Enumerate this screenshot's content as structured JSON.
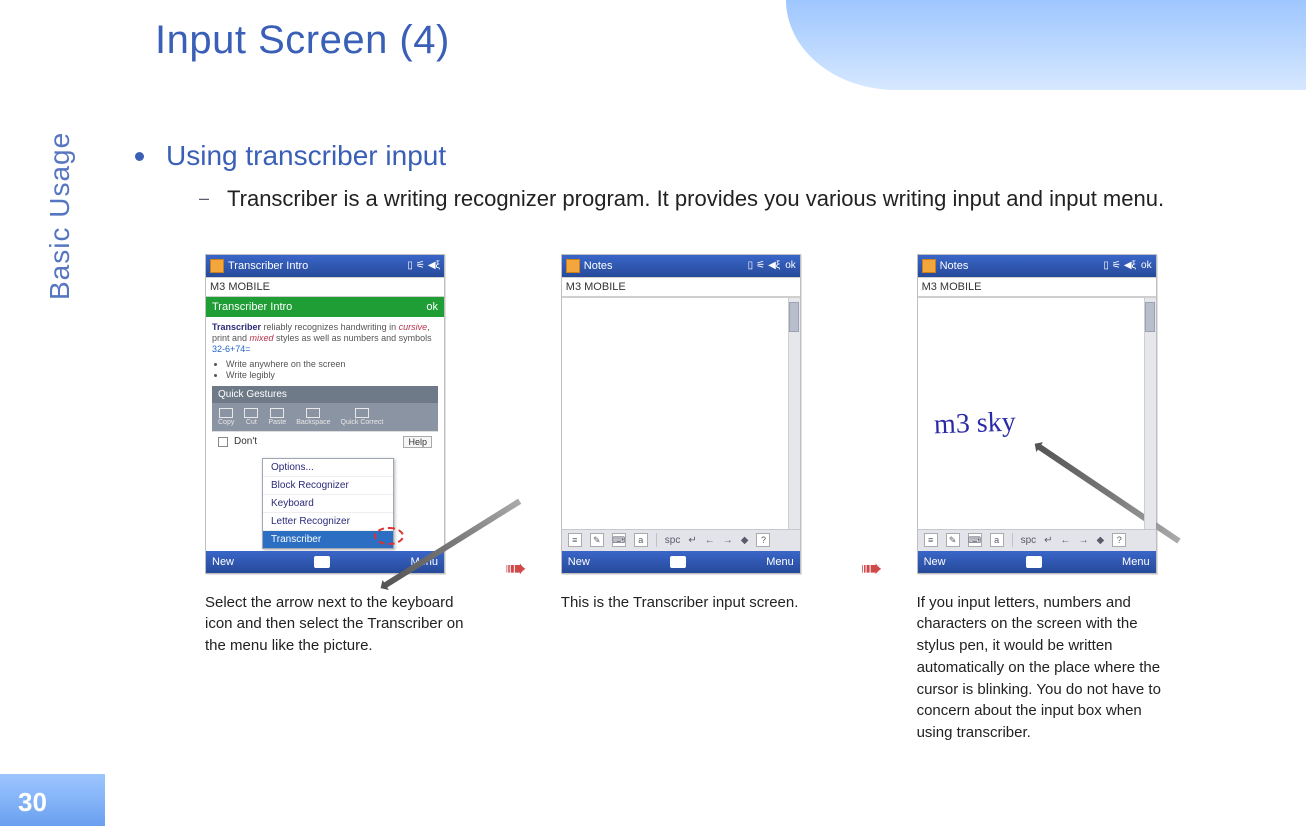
{
  "title": "Input Screen (4)",
  "side_label": "Basic Usage",
  "page_number": "30",
  "bullet": "Using transcriber input",
  "subpoint": "Transcriber is a writing recognizer program. It provides you various writing input and input menu.",
  "device1": {
    "title": "Transcriber Intro",
    "addr": "M3 MOBILE",
    "greenbar_title": "Transcriber Intro",
    "greenbar_ok": "ok",
    "intro_strong": "Transcriber",
    "intro_rest1": " reliably recognizes handwriting in ",
    "intro_cursive": "cursive",
    "intro_rest2": ", print and ",
    "intro_mixed": "mixed",
    "intro_rest3": " styles as well as numbers and symbols ",
    "intro_nums": "32-6+74=",
    "tips": [
      "Write anywhere on the screen",
      "Write legibly"
    ],
    "gestures_label": "Quick Gestures",
    "gesture_names": [
      "Copy",
      "Cut",
      "Paste",
      "Backspace",
      "Quick Correct"
    ],
    "dont_label": "Don't",
    "help_label": "Help",
    "popup": [
      "Options...",
      "Block Recognizer",
      "Keyboard",
      "Letter Recognizer",
      "Transcriber"
    ],
    "foot_new": "New",
    "foot_menu": "Menu"
  },
  "device2": {
    "title": "Notes",
    "addr": "M3 MOBILE",
    "ok": "ok",
    "toolbar_spc": "spc",
    "foot_new": "New",
    "foot_menu": "Menu"
  },
  "device3": {
    "title": "Notes",
    "addr": "M3 MOBILE",
    "ok": "ok",
    "handwriting": "m3 sky",
    "toolbar_spc": "spc",
    "foot_new": "New",
    "foot_menu": "Menu"
  },
  "captions": [
    "Select the arrow next to the keyboard icon and then select the Transcriber on the menu like the picture.",
    "This is the Transcriber input screen.",
    "If you input  letters, numbers and characters on the screen with the stylus pen, it would be written automatically on the place where the cursor is blinking. You do not have to concern about the input  box when using transcriber."
  ],
  "arrow_glyph": "➠"
}
